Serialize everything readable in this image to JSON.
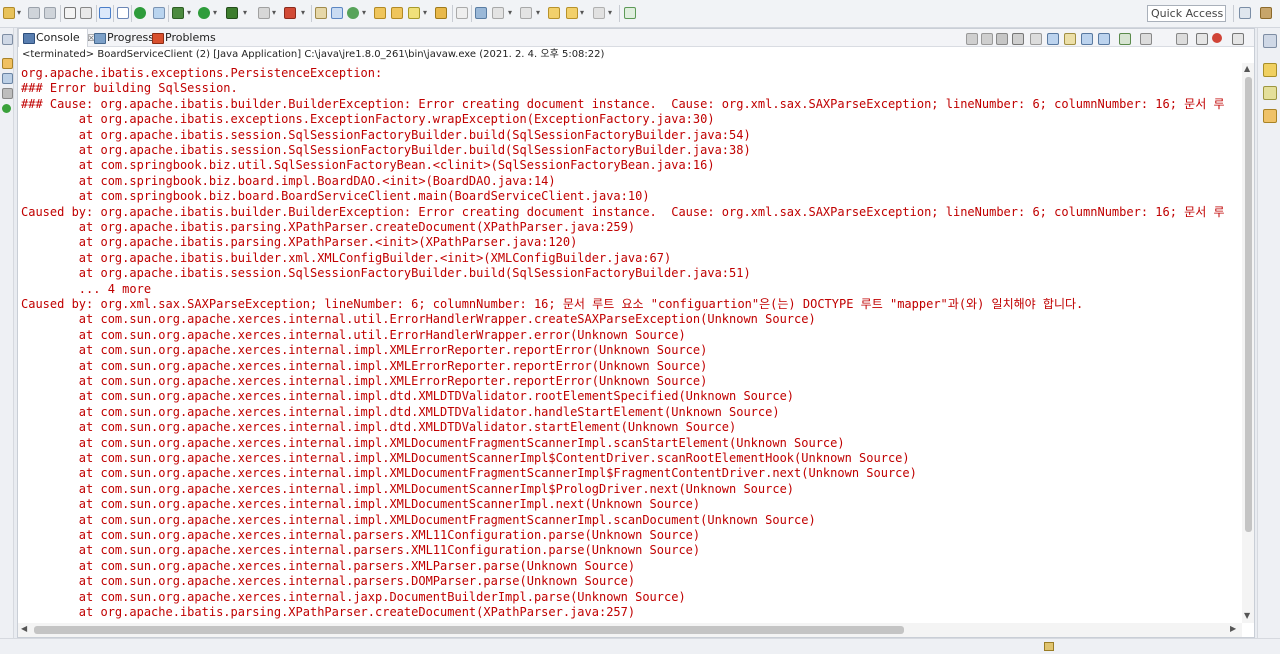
{
  "toolbar": {
    "quick_access": "Quick Access"
  },
  "tabs": [
    {
      "label": "Console",
      "close": "☒"
    },
    {
      "label": "Progress"
    },
    {
      "label": "Problems"
    }
  ],
  "console_header": "<terminated> BoardServiceClient (2) [Java Application] C:\\java\\jre1.8.0_261\\bin\\javaw.exe (2021. 2. 4. 오후 5:08:22)",
  "lines": [
    "org.apache.ibatis.exceptions.PersistenceException:",
    "### Error building SqlSession.",
    "### Cause: org.apache.ibatis.builder.BuilderException: Error creating document instance.  Cause: org.xml.sax.SAXParseException; lineNumber: 6; columnNumber: 16; 문서 루",
    "        at org.apache.ibatis.exceptions.ExceptionFactory.wrapException(ExceptionFactory.java:30)",
    "        at org.apache.ibatis.session.SqlSessionFactoryBuilder.build(SqlSessionFactoryBuilder.java:54)",
    "        at org.apache.ibatis.session.SqlSessionFactoryBuilder.build(SqlSessionFactoryBuilder.java:38)",
    "        at com.springbook.biz.util.SqlSessionFactoryBean.<clinit>(SqlSessionFactoryBean.java:16)",
    "        at com.springbook.biz.board.impl.BoardDAO.<init>(BoardDAO.java:14)",
    "        at com.springbook.biz.board.BoardServiceClient.main(BoardServiceClient.java:10)",
    "Caused by: org.apache.ibatis.builder.BuilderException: Error creating document instance.  Cause: org.xml.sax.SAXParseException; lineNumber: 6; columnNumber: 16; 문서 루",
    "        at org.apache.ibatis.parsing.XPathParser.createDocument(XPathParser.java:259)",
    "        at org.apache.ibatis.parsing.XPathParser.<init>(XPathParser.java:120)",
    "        at org.apache.ibatis.builder.xml.XMLConfigBuilder.<init>(XMLConfigBuilder.java:67)",
    "        at org.apache.ibatis.session.SqlSessionFactoryBuilder.build(SqlSessionFactoryBuilder.java:51)",
    "        ... 4 more",
    "Caused by: org.xml.sax.SAXParseException; lineNumber: 6; columnNumber: 16; 문서 루트 요소 \"configuartion\"은(는) DOCTYPE 루트 \"mapper\"과(와) 일치해야 합니다.",
    "        at com.sun.org.apache.xerces.internal.util.ErrorHandlerWrapper.createSAXParseException(Unknown Source)",
    "        at com.sun.org.apache.xerces.internal.util.ErrorHandlerWrapper.error(Unknown Source)",
    "        at com.sun.org.apache.xerces.internal.impl.XMLErrorReporter.reportError(Unknown Source)",
    "        at com.sun.org.apache.xerces.internal.impl.XMLErrorReporter.reportError(Unknown Source)",
    "        at com.sun.org.apache.xerces.internal.impl.XMLErrorReporter.reportError(Unknown Source)",
    "        at com.sun.org.apache.xerces.internal.impl.dtd.XMLDTDValidator.rootElementSpecified(Unknown Source)",
    "        at com.sun.org.apache.xerces.internal.impl.dtd.XMLDTDValidator.handleStartElement(Unknown Source)",
    "        at com.sun.org.apache.xerces.internal.impl.dtd.XMLDTDValidator.startElement(Unknown Source)",
    "        at com.sun.org.apache.xerces.internal.impl.XMLDocumentFragmentScannerImpl.scanStartElement(Unknown Source)",
    "        at com.sun.org.apache.xerces.internal.impl.XMLDocumentScannerImpl$ContentDriver.scanRootElementHook(Unknown Source)",
    "        at com.sun.org.apache.xerces.internal.impl.XMLDocumentFragmentScannerImpl$FragmentContentDriver.next(Unknown Source)",
    "        at com.sun.org.apache.xerces.internal.impl.XMLDocumentScannerImpl$PrologDriver.next(Unknown Source)",
    "        at com.sun.org.apache.xerces.internal.impl.XMLDocumentScannerImpl.next(Unknown Source)",
    "        at com.sun.org.apache.xerces.internal.impl.XMLDocumentFragmentScannerImpl.scanDocument(Unknown Source)",
    "        at com.sun.org.apache.xerces.internal.parsers.XML11Configuration.parse(Unknown Source)",
    "        at com.sun.org.apache.xerces.internal.parsers.XML11Configuration.parse(Unknown Source)",
    "        at com.sun.org.apache.xerces.internal.parsers.XMLParser.parse(Unknown Source)",
    "        at com.sun.org.apache.xerces.internal.parsers.DOMParser.parse(Unknown Source)",
    "        at com.sun.org.apache.xerces.internal.jaxp.DocumentBuilderImpl.parse(Unknown Source)",
    "        at org.apache.ibatis.parsing.XPathParser.createDocument(XPathParser.java:257)"
  ],
  "colors": {
    "error_text": "#c00000",
    "background": "#ffffff"
  }
}
